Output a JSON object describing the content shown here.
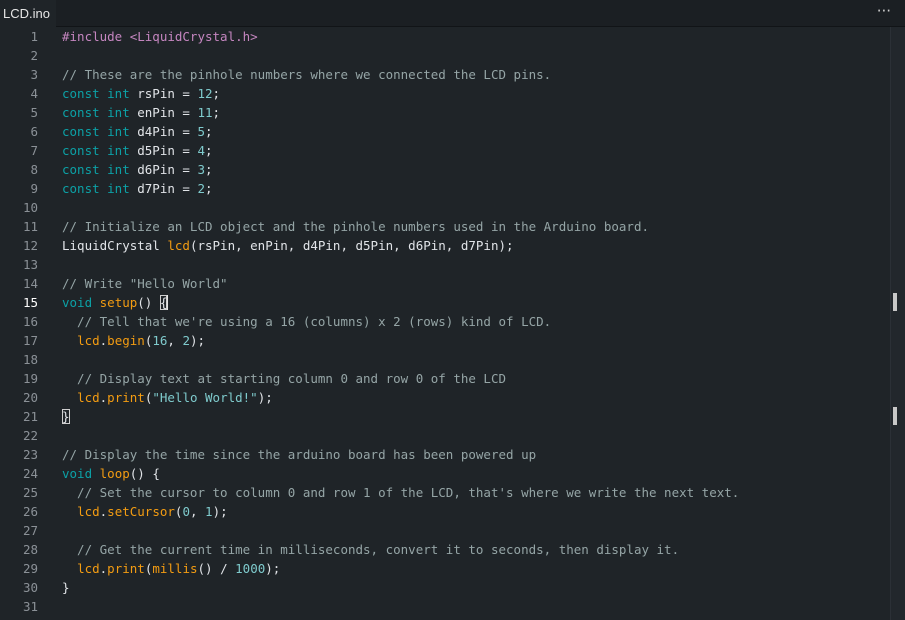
{
  "tab": {
    "title": "LCD.ino"
  },
  "toolbar": {
    "more_label": "···"
  },
  "editor": {
    "active_line": 15,
    "lines": [
      [
        [
          "pp",
          "#include <LiquidCrystal.h>"
        ]
      ],
      [],
      [
        [
          "cm",
          "// These are the pinhole numbers where we connected the LCD pins."
        ]
      ],
      [
        [
          "kw",
          "const int"
        ],
        [
          "",
          " rsPin = "
        ],
        [
          "num",
          "12"
        ],
        [
          "",
          ";"
        ]
      ],
      [
        [
          "kw",
          "const int"
        ],
        [
          "",
          " enPin = "
        ],
        [
          "num",
          "11"
        ],
        [
          "",
          ";"
        ]
      ],
      [
        [
          "kw",
          "const int"
        ],
        [
          "",
          " d4Pin = "
        ],
        [
          "num",
          "5"
        ],
        [
          "",
          ";"
        ]
      ],
      [
        [
          "kw",
          "const int"
        ],
        [
          "",
          " d5Pin = "
        ],
        [
          "num",
          "4"
        ],
        [
          "",
          ";"
        ]
      ],
      [
        [
          "kw",
          "const int"
        ],
        [
          "",
          " d6Pin = "
        ],
        [
          "num",
          "3"
        ],
        [
          "",
          ";"
        ]
      ],
      [
        [
          "kw",
          "const int"
        ],
        [
          "",
          " d7Pin = "
        ],
        [
          "num",
          "2"
        ],
        [
          "",
          ";"
        ]
      ],
      [],
      [
        [
          "cm",
          "// Initialize an LCD object and the pinhole numbers used in the Arduino board."
        ]
      ],
      [
        [
          "",
          "LiquidCrystal "
        ],
        [
          "fn",
          "lcd"
        ],
        [
          "",
          "(rsPin, enPin, d4Pin, d5Pin, d6Pin, d7Pin);"
        ]
      ],
      [],
      [
        [
          "cm",
          "// Write \"Hello World\""
        ]
      ],
      [
        [
          "kw",
          "void"
        ],
        [
          "",
          " "
        ],
        [
          "fn",
          "setup"
        ],
        [
          "",
          "() "
        ],
        [
          "br",
          "{"
        ],
        [
          "caret",
          ""
        ]
      ],
      [
        [
          "cm",
          "  // Tell that we're using a 16 (columns) x 2 (rows) kind of LCD."
        ]
      ],
      [
        [
          "",
          "  "
        ],
        [
          "fn",
          "lcd"
        ],
        [
          "",
          "."
        ],
        [
          "fn",
          "begin"
        ],
        [
          "",
          "("
        ],
        [
          "num",
          "16"
        ],
        [
          "",
          ", "
        ],
        [
          "num",
          "2"
        ],
        [
          "",
          ");"
        ]
      ],
      [],
      [
        [
          "cm",
          "  // Display text at starting column 0 and row 0 of the LCD"
        ]
      ],
      [
        [
          "",
          "  "
        ],
        [
          "fn",
          "lcd"
        ],
        [
          "",
          "."
        ],
        [
          "fn",
          "print"
        ],
        [
          "",
          "("
        ],
        [
          "str",
          "\"Hello World!\""
        ],
        [
          "",
          ");"
        ]
      ],
      [
        [
          "br",
          "}"
        ]
      ],
      [],
      [
        [
          "cm",
          "// Display the time since the arduino board has been powered up"
        ]
      ],
      [
        [
          "kw",
          "void"
        ],
        [
          "",
          " "
        ],
        [
          "fn",
          "loop"
        ],
        [
          "",
          "() {"
        ]
      ],
      [
        [
          "cm",
          "  // Set the cursor to column 0 and row 1 of the LCD, that's where we write the next text."
        ]
      ],
      [
        [
          "",
          "  "
        ],
        [
          "fn",
          "lcd"
        ],
        [
          "",
          "."
        ],
        [
          "fn",
          "setCursor"
        ],
        [
          "",
          "("
        ],
        [
          "num",
          "0"
        ],
        [
          "",
          ", "
        ],
        [
          "num",
          "1"
        ],
        [
          "",
          ");"
        ]
      ],
      [],
      [
        [
          "cm",
          "  // Get the current time in milliseconds, convert it to seconds, then display it."
        ]
      ],
      [
        [
          "",
          "  "
        ],
        [
          "fn",
          "lcd"
        ],
        [
          "",
          "."
        ],
        [
          "fn",
          "print"
        ],
        [
          "",
          "("
        ],
        [
          "fn",
          "millis"
        ],
        [
          "",
          "() / "
        ],
        [
          "num",
          "1000"
        ],
        [
          "",
          ");"
        ]
      ],
      [
        [
          "",
          "}"
        ]
      ],
      []
    ]
  },
  "scrollbar": {
    "marker_lines": [
      15,
      21
    ]
  }
}
